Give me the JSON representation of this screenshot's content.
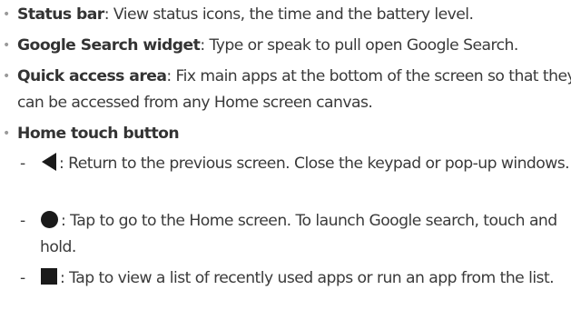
{
  "items": [
    {
      "term": "Status bar",
      "description": ": View status icons, the time and the battery level."
    },
    {
      "term": "Google Search widget",
      "description": ": Type or speak to pull open Google Search."
    },
    {
      "term": "Quick access area",
      "description": ": Fix main apps at the bottom of the screen so that they can be accessed from any Home screen canvas."
    },
    {
      "term": "Home touch button",
      "description": ""
    }
  ],
  "sub_items": [
    {
      "icon": "back-triangle-icon",
      "text": ": Return to the previous screen. Close the keypad or pop-up windows."
    },
    {
      "icon": "home-circle-icon",
      "text": ": Tap to go to the Home screen. To launch Google search, touch and hold."
    },
    {
      "icon": "recent-apps-square-icon",
      "text": ": Tap to view a list of recently used apps or run an app from the list."
    }
  ],
  "symbols": {
    "bullet": "•",
    "dash": "-"
  },
  "colors": {
    "text": "#3a3a3a",
    "bullet": "#9a9a9a",
    "icon": "#1a1a1a"
  }
}
